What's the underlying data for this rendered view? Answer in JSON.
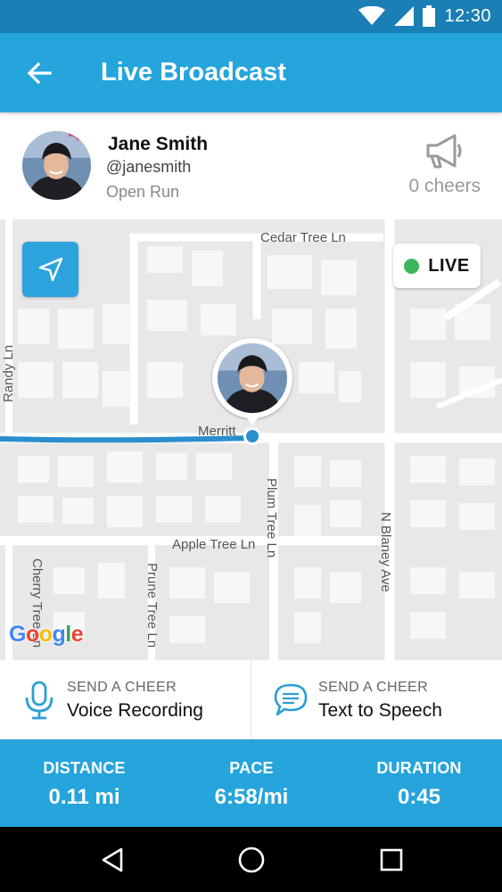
{
  "status_bar": {
    "time": "12:30",
    "icons": [
      "wifi-icon",
      "signal-icon",
      "battery-icon"
    ]
  },
  "app_bar": {
    "title": "Live Broadcast",
    "back_icon": "arrow-back-icon"
  },
  "profile": {
    "name": "Jane Smith",
    "handle": "@janesmith",
    "activity": "Open Run",
    "cheers_icon": "megaphone-icon",
    "cheers": "0 cheers"
  },
  "map": {
    "live_label": "LIVE",
    "live_color": "#3cb55a",
    "locate_icon": "navigation-arrow-icon",
    "streets": [
      "Cedar Tree Ln",
      "Merritt",
      "Apple Tree Ln",
      "Plum Tree Ln",
      "N Blaney Ave",
      "Randy Ln",
      "Cherry Tree Ln",
      "Prune Tree Ln"
    ],
    "attribution": "Google"
  },
  "cheer_actions": [
    {
      "sublabel": "SEND A CHEER",
      "label": "Voice Recording",
      "icon": "microphone-icon"
    },
    {
      "sublabel": "SEND A CHEER",
      "label": "Text to Speech",
      "icon": "speech-bubble-icon"
    }
  ],
  "stats": [
    {
      "label": "DISTANCE",
      "value": "0.11 mi"
    },
    {
      "label": "PACE",
      "value": "6:58/mi"
    },
    {
      "label": "DURATION",
      "value": "0:45"
    }
  ],
  "nav_bar": {
    "icons": [
      "back-triangle-icon",
      "home-circle-icon",
      "recents-square-icon"
    ]
  },
  "colors": {
    "primary": "#26a4dc",
    "status_bar": "#1a7fb4",
    "route": "#2a8fcf"
  }
}
